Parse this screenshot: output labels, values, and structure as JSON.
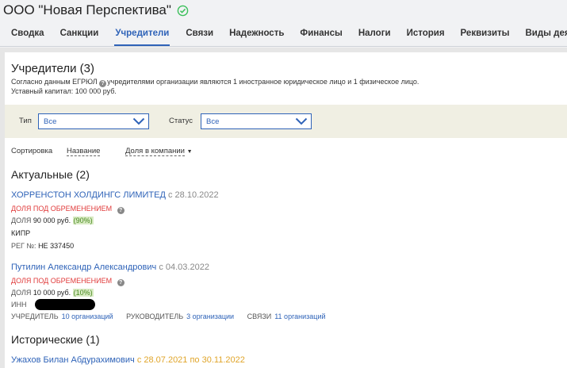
{
  "company": {
    "name": "ООО \"Новая Перспектива\""
  },
  "tabs": [
    {
      "label": "Сводка"
    },
    {
      "label": "Санкции"
    },
    {
      "label": "Учредители"
    },
    {
      "label": "Связи"
    },
    {
      "label": "Надежность"
    },
    {
      "label": "Финансы"
    },
    {
      "label": "Налоги"
    },
    {
      "label": "История"
    },
    {
      "label": "Реквизиты"
    },
    {
      "label": "Виды деят"
    }
  ],
  "section": {
    "title": "Учредители (3)",
    "note_prefix": "Согласно данным ЕГРЮЛ",
    "note_suffix": "учредителями организации являются 1 иностранное юридическое лицо и 1 физическое лицо.",
    "capital": "Уставный капитал: 100 000 руб."
  },
  "filters": {
    "type_label": "Тип",
    "type_value": "Все",
    "status_label": "Статус",
    "status_value": "Все"
  },
  "sort": {
    "label": "Сортировка",
    "by_name": "Название",
    "by_share": "Доля в компании"
  },
  "actual": {
    "title": "Актуальные (2)",
    "founders": [
      {
        "name": "ХОРРЕНСТОН ХОЛДИНГС ЛИМИТЕД",
        "since": "с 28.10.2022",
        "encumbrance": "ДОЛЯ ПОД ОБРЕМЕНЕНИЕМ",
        "share_label": "ДОЛЯ",
        "share_value": "90 000 руб.",
        "share_pct": "(90%)",
        "country": "КИПР",
        "reg_label": "РЕГ №:",
        "reg_value": "HE 337450"
      },
      {
        "name": "Путилин Александр Александрович",
        "since": "с 04.03.2022",
        "encumbrance": "ДОЛЯ ПОД ОБРЕМЕНЕНИЕМ",
        "share_label": "ДОЛЯ",
        "share_value": "10 000 руб.",
        "share_pct": "(10%)",
        "inn_label": "ИНН",
        "founder_label": "УЧРЕДИТЕЛЬ",
        "founder_link": "10 организаций",
        "head_label": "РУКОВОДИТЕЛЬ",
        "head_link": "3 организации",
        "links_label": "СВЯЗИ",
        "links_link": "11 организаций"
      }
    ]
  },
  "historical": {
    "title": "Исторические (1)",
    "founders": [
      {
        "name": "Ужахов Билан Абдурахимович",
        "period": "с 28.07.2021 по 30.11.2022"
      }
    ]
  },
  "colors": {
    "accent": "#2f63b8",
    "alert": "#e03a3a",
    "ok": "#3bbf5a",
    "historic": "#e0a52a",
    "filter_bg": "#f0efe3"
  }
}
